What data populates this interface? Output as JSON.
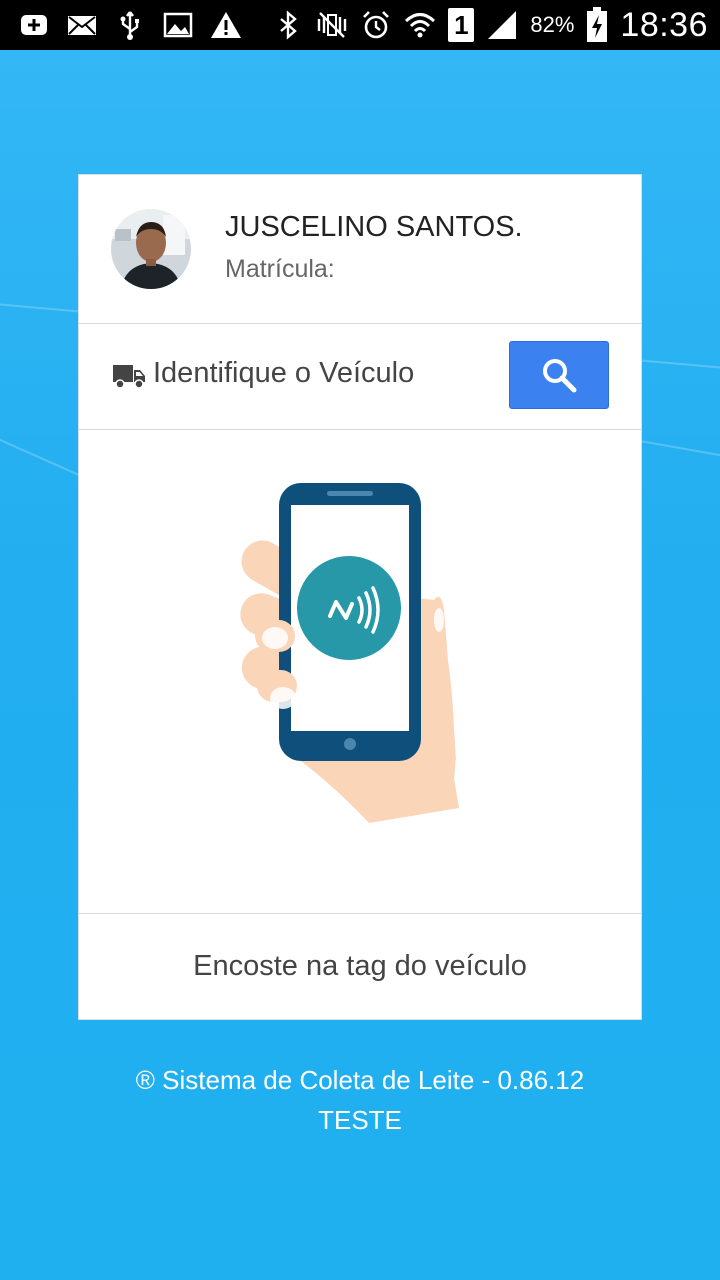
{
  "status_bar": {
    "battery_percent": "82%",
    "time": "18:36",
    "sim_slot": "1",
    "left_icons": [
      "add-icon",
      "mail-icon",
      "usb-icon",
      "image-icon",
      "warning-icon"
    ],
    "right_icons": [
      "bluetooth-icon",
      "vibrate-icon",
      "alarm-icon",
      "wifi-icon",
      "sim-icon",
      "signal-icon",
      "battery-charging-icon"
    ]
  },
  "profile": {
    "name": "JUSCELINO SANTOS.",
    "registration_label": "Matrícula:"
  },
  "vehicle": {
    "identify_label": "Identifique o Veículo",
    "icon": "truck-icon",
    "search_icon": "search-icon"
  },
  "nfc": {
    "illustration": "hand-phone-nfc-icon",
    "hint": "Encoste na tag do veículo"
  },
  "footer": {
    "app_line": "® Sistema de Coleta de Leite - 0.86.12",
    "env_line": "TESTE"
  },
  "colors": {
    "background": "#22aef0",
    "search_button": "#3b82f0",
    "phone_frame": "#0e4f7c",
    "nfc_circle": "#2698a7",
    "hand": "#fbd5b8"
  }
}
